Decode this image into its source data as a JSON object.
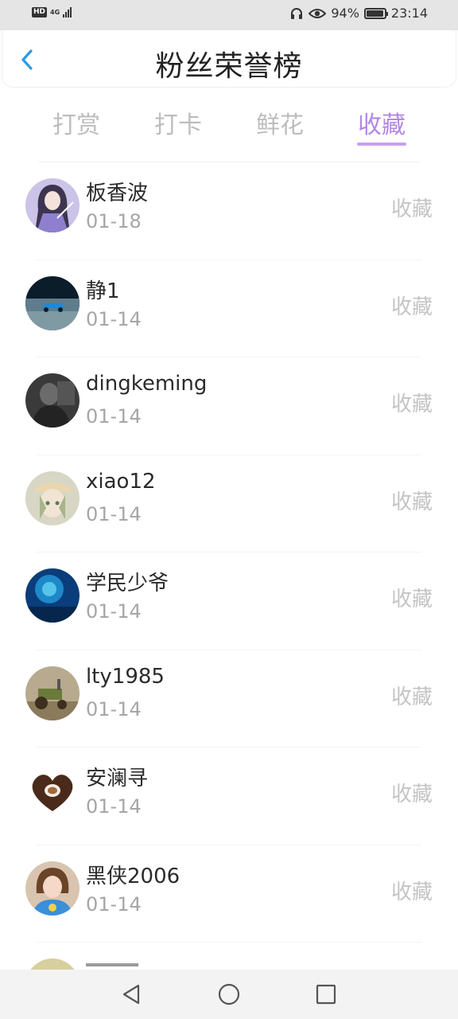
{
  "status_bar": {
    "hd_label": "HD",
    "network_label": "4G",
    "battery_percent": "94%",
    "battery_level": 0.94,
    "time": "23:14",
    "icons": [
      "headphones-icon",
      "eye-icon",
      "battery-icon",
      "signal-icon"
    ]
  },
  "header": {
    "title": "粉丝荣誉榜",
    "back_icon": "chevron-left-icon",
    "accent_color": "#2a9be8"
  },
  "tabs": {
    "items": [
      {
        "label": "打赏",
        "active": false
      },
      {
        "label": "打卡",
        "active": false
      },
      {
        "label": "鲜花",
        "active": false
      },
      {
        "label": "收藏",
        "active": true
      }
    ],
    "active_color": "#b487e6",
    "inactive_color": "#bdbdbd"
  },
  "fans": [
    {
      "name": "板香波",
      "date": "01-18",
      "action": "收藏",
      "avatar": "anime-girl-avatar"
    },
    {
      "name": "静1",
      "date": "01-14",
      "action": "收藏",
      "avatar": "blue-car-avatar"
    },
    {
      "name": "dingkeming",
      "date": "01-14",
      "action": "收藏",
      "avatar": "dark-photo-avatar"
    },
    {
      "name": "xiao12",
      "date": "01-14",
      "action": "收藏",
      "avatar": "anime-cap-avatar"
    },
    {
      "name": "学民少爷",
      "date": "01-14",
      "action": "收藏",
      "avatar": "ocean-avatar"
    },
    {
      "name": "lty1985",
      "date": "01-14",
      "action": "收藏",
      "avatar": "tractor-avatar"
    },
    {
      "name": "安澜寻",
      "date": "01-14",
      "action": "收藏",
      "avatar": "coffee-heart-avatar"
    },
    {
      "name": "黑侠2006",
      "date": "01-14",
      "action": "收藏",
      "avatar": "woman-photo-avatar"
    }
  ],
  "nav_bar": {
    "icons": [
      "back-triangle-icon",
      "home-circle-icon",
      "recents-square-icon"
    ]
  }
}
